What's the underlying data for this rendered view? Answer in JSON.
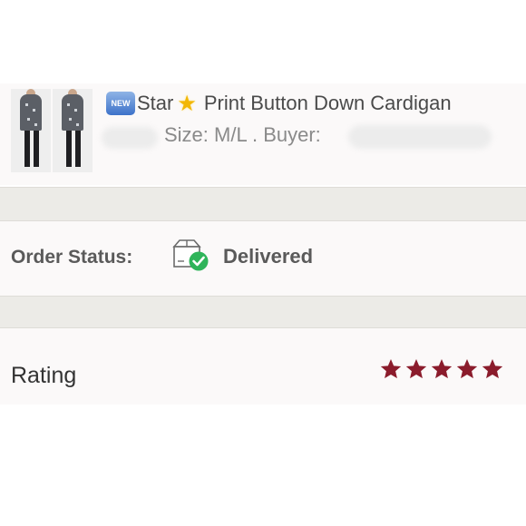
{
  "product": {
    "badge": "NEW",
    "title_start": "Star",
    "title_end": "Print Button Down Cardigan",
    "size_text": "Size: M/L . Buyer:"
  },
  "order": {
    "status_label": "Order Status:",
    "status_value": "Delivered",
    "status_icon": "box-check-icon"
  },
  "rating": {
    "label": "Rating",
    "stars": 5,
    "max_stars": 5,
    "star_color": "#8b1c2c"
  },
  "colors": {
    "row_background": "#fbf9f9",
    "divider": "#ecebe7",
    "check_green": "#2fb45a",
    "text": "#5a5a5a"
  }
}
